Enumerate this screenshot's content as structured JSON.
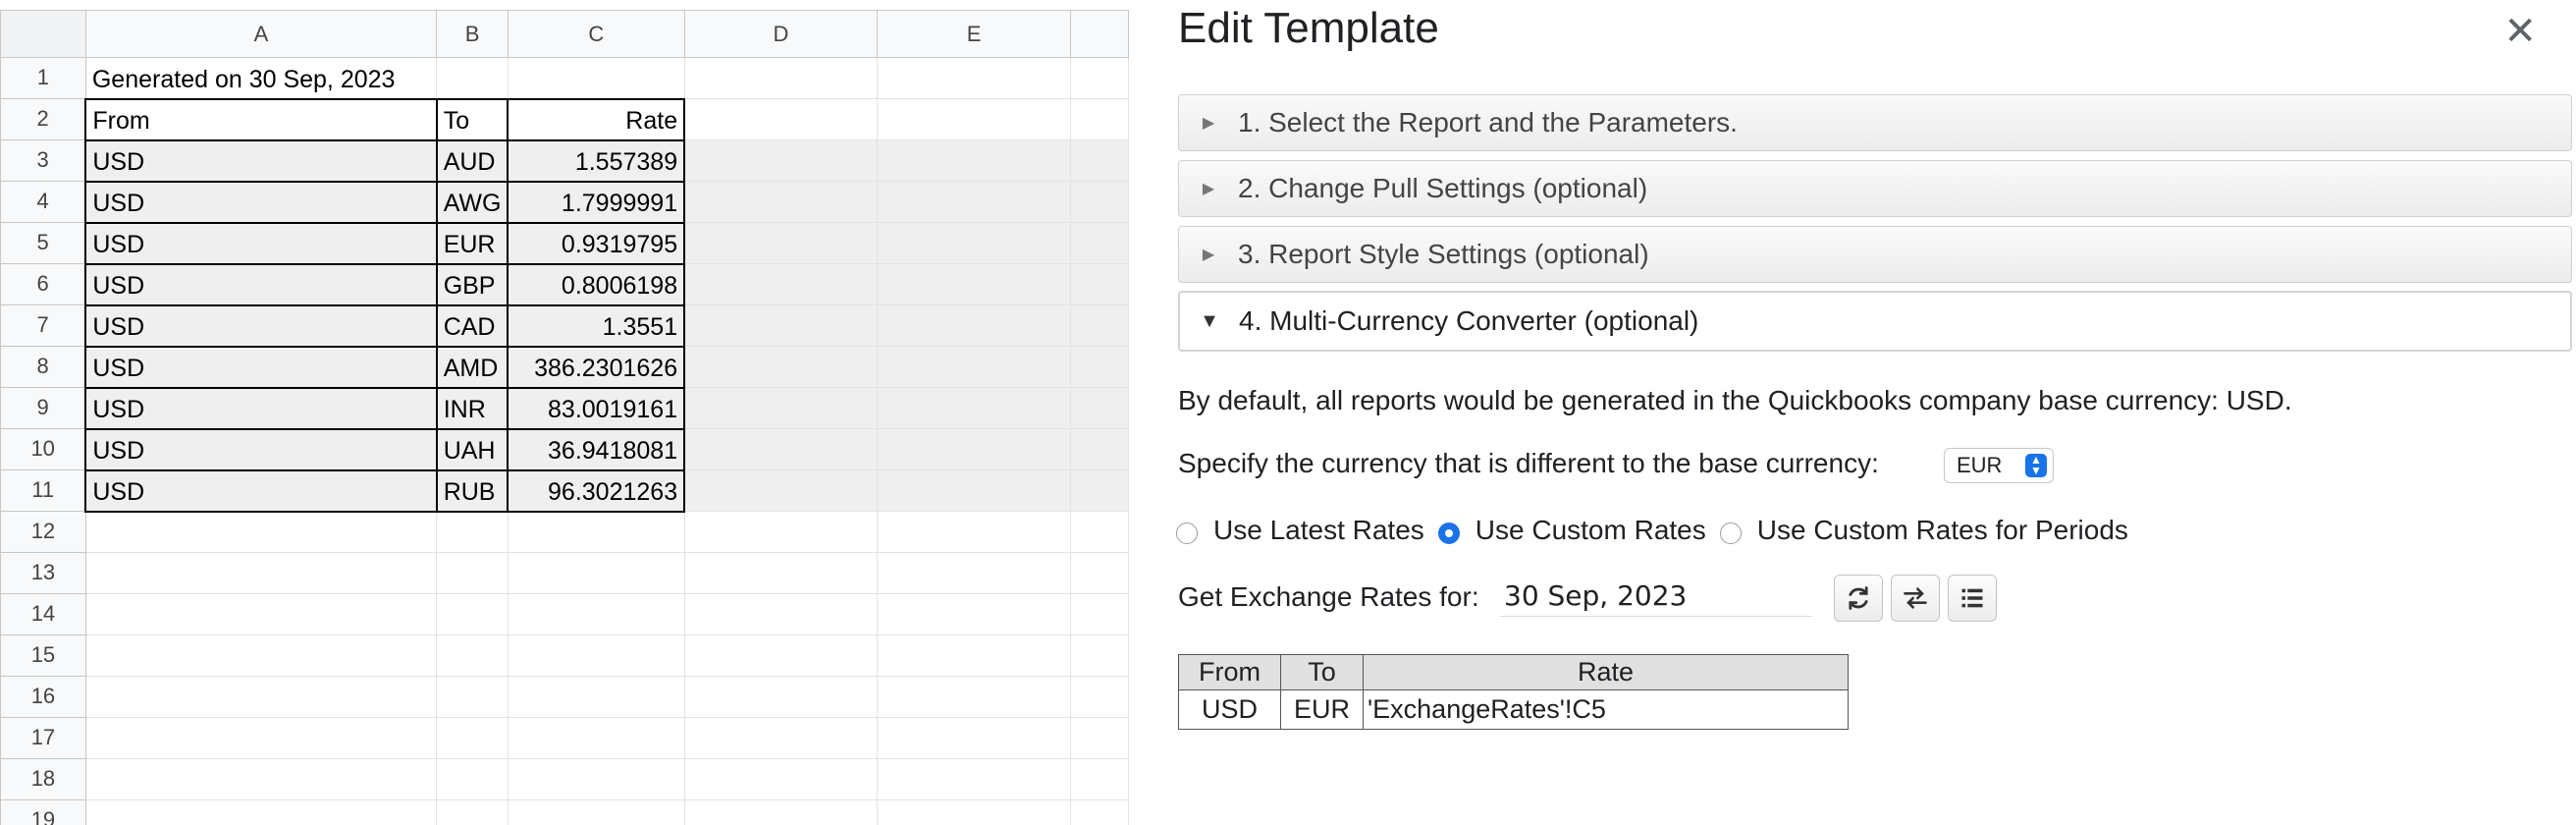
{
  "sheet": {
    "columns": [
      "A",
      "B",
      "C",
      "D",
      "E"
    ],
    "rows": [
      {
        "n": "1",
        "a": "Generated on 30 Sep, 2023",
        "b": "",
        "c": ""
      },
      {
        "n": "2",
        "a": "From",
        "b": "To",
        "c": "Rate"
      },
      {
        "n": "3",
        "a": "USD",
        "b": "AUD",
        "c": "1.557389"
      },
      {
        "n": "4",
        "a": "USD",
        "b": "AWG",
        "c": "1.7999991"
      },
      {
        "n": "5",
        "a": "USD",
        "b": "EUR",
        "c": "0.9319795"
      },
      {
        "n": "6",
        "a": "USD",
        "b": "GBP",
        "c": "0.8006198"
      },
      {
        "n": "7",
        "a": "USD",
        "b": "CAD",
        "c": "1.3551"
      },
      {
        "n": "8",
        "a": "USD",
        "b": "AMD",
        "c": "386.2301626"
      },
      {
        "n": "9",
        "a": "USD",
        "b": "INR",
        "c": "83.0019161"
      },
      {
        "n": "10",
        "a": "USD",
        "b": "UAH",
        "c": "36.9418081"
      },
      {
        "n": "11",
        "a": "USD",
        "b": "RUB",
        "c": "96.3021263"
      },
      {
        "n": "12",
        "a": "",
        "b": "",
        "c": ""
      },
      {
        "n": "13",
        "a": "",
        "b": "",
        "c": ""
      },
      {
        "n": "14",
        "a": "",
        "b": "",
        "c": ""
      },
      {
        "n": "15",
        "a": "",
        "b": "",
        "c": ""
      },
      {
        "n": "16",
        "a": "",
        "b": "",
        "c": ""
      },
      {
        "n": "17",
        "a": "",
        "b": "",
        "c": ""
      },
      {
        "n": "18",
        "a": "",
        "b": "",
        "c": ""
      },
      {
        "n": "19",
        "a": "",
        "b": "",
        "c": ""
      }
    ]
  },
  "panel": {
    "title": "Edit Template",
    "close_glyph": "✕",
    "sections": [
      {
        "label": "1. Select the Report and the Parameters.",
        "open": false
      },
      {
        "label": "2. Change Pull Settings (optional)",
        "open": false
      },
      {
        "label": "3. Report Style Settings (optional)",
        "open": false
      },
      {
        "label": "4. Multi-Currency Converter (optional)",
        "open": true
      }
    ],
    "collapsed_glyph": "▶",
    "expanded_glyph": "▼",
    "base_currency_text": "By default, all reports would be generated in the Quickbooks company base currency: USD.",
    "specify_text": "Specify the currency that is different to the base currency:",
    "currency_select": {
      "value": "EUR"
    },
    "radios": [
      {
        "label": "Use Latest Rates",
        "checked": false
      },
      {
        "label": "Use Custom Rates",
        "checked": true
      },
      {
        "label": "Use Custom Rates for Periods",
        "checked": false
      }
    ],
    "exchange_label": "Get Exchange Rates for:",
    "exchange_date": "30 Sep, 2023",
    "icons": [
      "refresh-icon",
      "swap-icon",
      "list-icon"
    ],
    "rates_table": {
      "headers": [
        "From",
        "To",
        "Rate"
      ],
      "rows": [
        {
          "from": "USD",
          "to": "EUR",
          "rate": "'ExchangeRates'!C5"
        }
      ]
    },
    "accent_color": "#1a73e8"
  }
}
